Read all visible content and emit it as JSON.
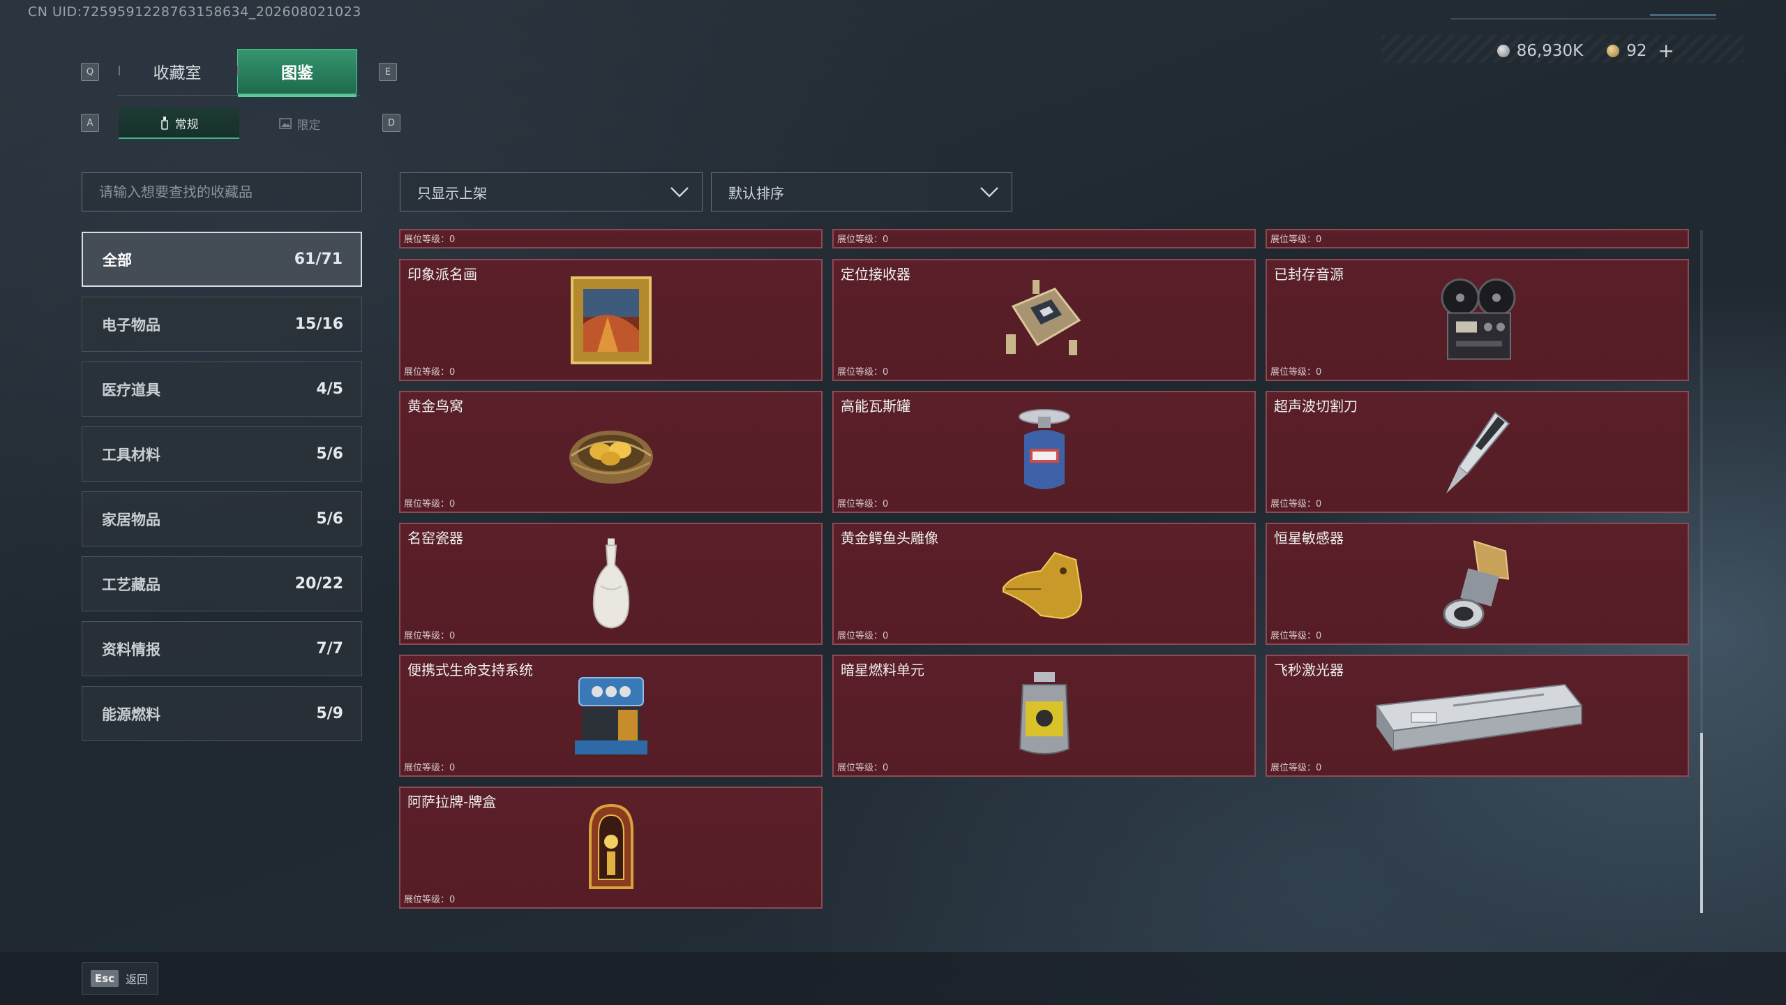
{
  "uid_text": "CN UID:7259591228763158634_202608021023",
  "currency": {
    "silver_icon": "silver-coin-icon",
    "silver": "86,930K",
    "gold_icon": "gold-coin-icon",
    "gold": "92",
    "plus": "+"
  },
  "keys": {
    "prev_tab": "Q",
    "next_tab": "E",
    "prev_sub": "A",
    "next_sub": "D"
  },
  "main_tabs": [
    {
      "label": "收藏室",
      "active": false
    },
    {
      "label": "图鉴",
      "active": true
    }
  ],
  "sub_tabs": [
    {
      "label": "常规",
      "icon": "bottle-icon",
      "active": true
    },
    {
      "label": "限定",
      "icon": "image-icon",
      "active": false
    }
  ],
  "search": {
    "placeholder": "请输入想要查找的收藏品",
    "value": ""
  },
  "filters": {
    "shelf": "只显示上架",
    "sort": "默认排序"
  },
  "categories": [
    {
      "label": "全部",
      "count": "61/71",
      "active": true
    },
    {
      "label": "电子物品",
      "count": "15/16"
    },
    {
      "label": "医疗道具",
      "count": "4/5"
    },
    {
      "label": "工具材料",
      "count": "5/6"
    },
    {
      "label": "家居物品",
      "count": "5/6"
    },
    {
      "label": "工艺藏品",
      "count": "20/22"
    },
    {
      "label": "资料情报",
      "count": "7/7"
    },
    {
      "label": "能源燃料",
      "count": "5/9"
    }
  ],
  "level_label": "展位等级：0",
  "items": [
    {
      "name": "印象派名画",
      "icon": "painting-icon"
    },
    {
      "name": "定位接收器",
      "icon": "receiver-icon"
    },
    {
      "name": "已封存音源",
      "icon": "tape-recorder-icon"
    },
    {
      "name": "黄金鸟窝",
      "icon": "golden-nest-icon"
    },
    {
      "name": "高能瓦斯罐",
      "icon": "gas-canister-icon"
    },
    {
      "name": "超声波切割刀",
      "icon": "ultrasonic-cutter-icon"
    },
    {
      "name": "名窑瓷器",
      "icon": "porcelain-vase-icon"
    },
    {
      "name": "黄金鳄鱼头雕像",
      "icon": "golden-crocodile-icon"
    },
    {
      "name": "恒星敏感器",
      "icon": "star-sensor-icon"
    },
    {
      "name": "便携式生命支持系统",
      "icon": "life-support-icon"
    },
    {
      "name": "暗星燃料单元",
      "icon": "fuel-cell-icon"
    },
    {
      "name": "飞秒激光器",
      "icon": "laser-device-icon"
    },
    {
      "name": "阿萨拉牌-牌盒",
      "icon": "card-box-icon"
    }
  ],
  "esc": {
    "key": "Esc",
    "label": "返回"
  }
}
